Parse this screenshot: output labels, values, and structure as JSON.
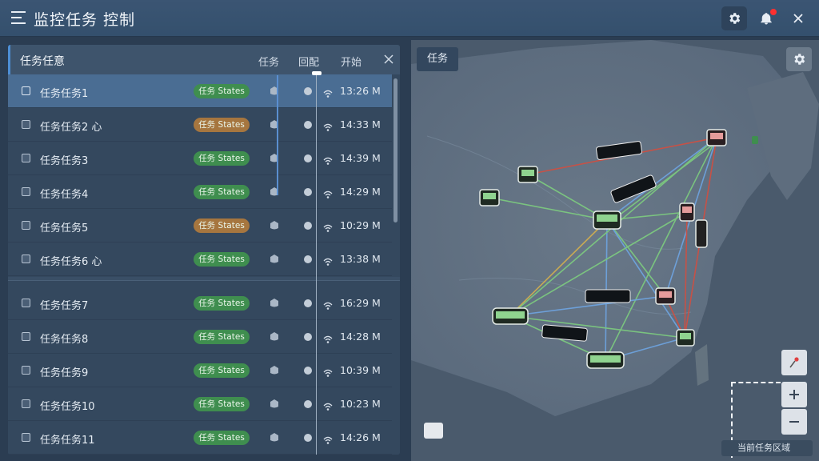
{
  "app": {
    "title": "监控任务 控制",
    "accent_color": "#4d8fd6",
    "notification_dot_color": "#ff3030"
  },
  "task_panel": {
    "title": "任务任意",
    "columns": [
      "任务",
      "回配",
      "开始"
    ],
    "rows": [
      {
        "name": "任务任务1",
        "status": "任务 States",
        "status_color": "green",
        "time": "13:26 M",
        "selected": true
      },
      {
        "name": "任务任务2 心",
        "status": "任务 States",
        "status_color": "orange",
        "time": "14:33 M",
        "selected": false
      },
      {
        "name": "任务任务3",
        "status": "任务 States",
        "status_color": "green",
        "time": "14:39 M",
        "selected": false
      },
      {
        "name": "任务任务4",
        "status": "任务 States",
        "status_color": "green",
        "time": "14:29 M",
        "selected": false
      },
      {
        "name": "任务任务5",
        "status": "任务 States",
        "status_color": "orange",
        "time": "10:29 M",
        "selected": false
      },
      {
        "name": "任务任务6 心",
        "status": "任务 States",
        "status_color": "green",
        "time": "13:38 M",
        "selected": false
      },
      {
        "name": "任务任务7",
        "status": "任务 States",
        "status_color": "green",
        "time": "16:29 M",
        "selected": false
      },
      {
        "name": "任务任务8",
        "status": "任务 States",
        "status_color": "green",
        "time": "14:28 M",
        "selected": false
      },
      {
        "name": "任务任务9",
        "status": "任务 States",
        "status_color": "green",
        "time": "10:39 M",
        "selected": false
      },
      {
        "name": "任务任务10",
        "status": "任务 States",
        "status_color": "green",
        "time": "10:23 M",
        "selected": false
      },
      {
        "name": "任务任务11",
        "status": "任务 States",
        "status_color": "green",
        "time": "14:26 M",
        "selected": false
      }
    ]
  },
  "map": {
    "tab_label": "任务",
    "footer_label": "当前任务区域",
    "icons": [
      "settings-icon",
      "pin-icon",
      "zoom-in-icon",
      "zoom-out-icon"
    ]
  }
}
